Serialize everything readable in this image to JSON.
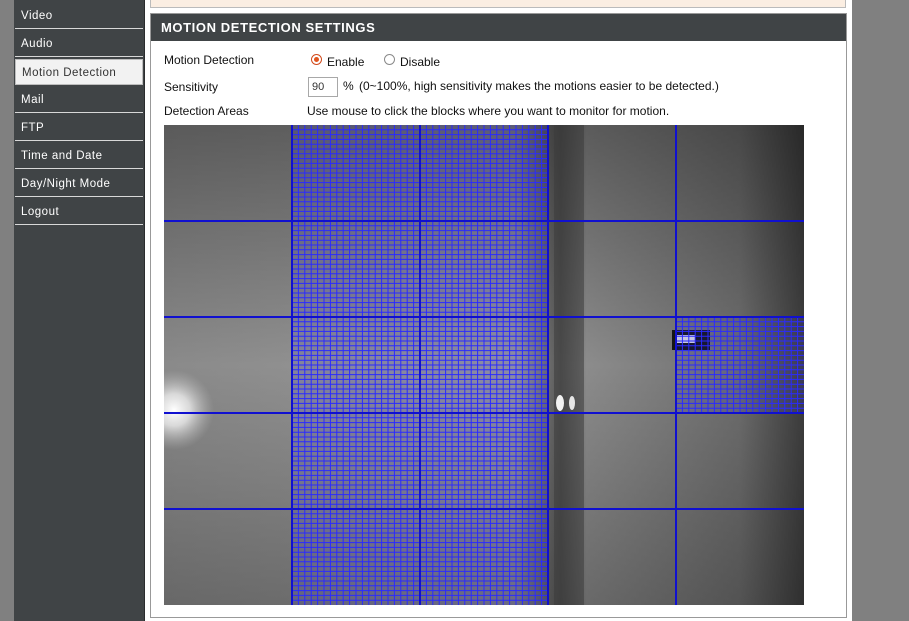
{
  "sidebar": {
    "items": [
      {
        "label": "Video",
        "active": false
      },
      {
        "label": "Audio",
        "active": false
      },
      {
        "label": "Motion Detection",
        "active": true
      },
      {
        "label": "Mail",
        "active": false
      },
      {
        "label": "FTP",
        "active": false
      },
      {
        "label": "Time and Date",
        "active": false
      },
      {
        "label": "Day/Night Mode",
        "active": false
      },
      {
        "label": "Logout",
        "active": false
      }
    ]
  },
  "panel": {
    "title": "MOTION DETECTION SETTINGS",
    "motion_detection": {
      "label": "Motion Detection",
      "enable_label": "Enable",
      "disable_label": "Disable",
      "selected": "Enable"
    },
    "sensitivity": {
      "label": "Sensitivity",
      "value": "90",
      "unit": "%",
      "hint": "(0~100%, high sensitivity makes the motions easier to be detected.)"
    },
    "detection_areas": {
      "label": "Detection Areas",
      "hint": "Use mouse to click the blocks where you want to monitor for motion."
    }
  },
  "detection_grid": {
    "columns": 5,
    "rows": 5,
    "subdivisions": 20,
    "selected_blocks": [
      [
        0,
        1
      ],
      [
        1,
        1
      ],
      [
        2,
        1
      ],
      [
        3,
        1
      ],
      [
        4,
        1
      ],
      [
        0,
        2
      ],
      [
        1,
        2
      ],
      [
        2,
        2
      ],
      [
        3,
        2
      ],
      [
        4,
        2
      ],
      [
        2,
        4
      ]
    ],
    "line_color": "#1010d0",
    "highlight_color": "#2a2aff"
  },
  "colors": {
    "sidebar_bg": "#404446",
    "header_bg": "#404446",
    "radio_accent": "#e0541e"
  }
}
